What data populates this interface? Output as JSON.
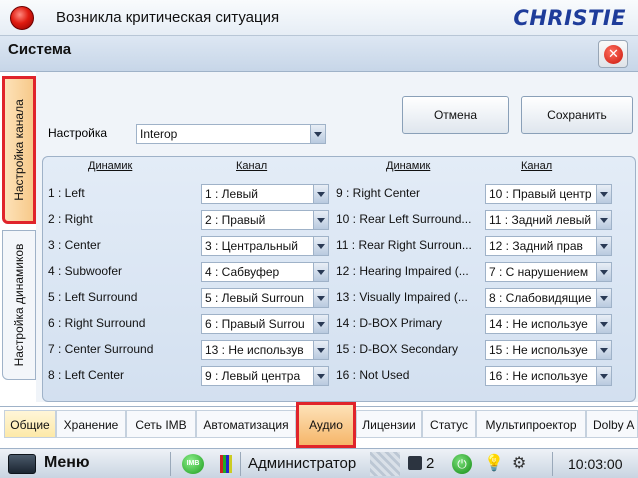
{
  "alert": {
    "text": "Возникла критическая ситуация"
  },
  "brand": "CHRISTIE",
  "window": {
    "title": "Система",
    "close_icon": "close-icon"
  },
  "side_tabs": [
    {
      "label": "Настройка канала",
      "active": true
    },
    {
      "label": "Настройка динамиков",
      "active": false
    }
  ],
  "actions": {
    "cancel": "Отмена",
    "save": "Сохранить"
  },
  "preset": {
    "label": "Настройка",
    "value": "Interop"
  },
  "columns": {
    "speaker": "Динамик",
    "channel": "Канал"
  },
  "speakers_left": [
    {
      "speaker": "1 : Left",
      "channel": "1 : Левый"
    },
    {
      "speaker": "2 : Right",
      "channel": "2 : Правый"
    },
    {
      "speaker": "3 : Center",
      "channel": "3 : Центральный"
    },
    {
      "speaker": "4 : Subwoofer",
      "channel": "4 : Сабвуфер"
    },
    {
      "speaker": "5 : Left Surround",
      "channel": "5 : Левый Surroun"
    },
    {
      "speaker": "6 : Right Surround",
      "channel": "6 : Правый Surrou"
    },
    {
      "speaker": "7 : Center Surround",
      "channel": "13 : Не использув"
    },
    {
      "speaker": "8 : Left Center",
      "channel": "9 : Левый центра"
    }
  ],
  "speakers_right": [
    {
      "speaker": "9 : Right Center",
      "channel": "10 : Правый центр"
    },
    {
      "speaker": "10 : Rear Left Surround...",
      "channel": "11 : Задний левый"
    },
    {
      "speaker": "11 : Rear Right Surroun...",
      "channel": "12 : Задний прав"
    },
    {
      "speaker": "12 : Hearing Impaired (...",
      "channel": "7 : С нарушением"
    },
    {
      "speaker": "13 : Visually Impaired (...",
      "channel": "8 : Слабовидящие"
    },
    {
      "speaker": "14 : D-BOX Primary",
      "channel": "14 : Не используе"
    },
    {
      "speaker": "15 : D-BOX Secondary",
      "channel": "15 : Не используе"
    },
    {
      "speaker": "16 : Not Used",
      "channel": "16 : Не используе"
    }
  ],
  "bottom_tabs": [
    {
      "label": "Общие"
    },
    {
      "label": "Хранение"
    },
    {
      "label": "Сеть IMB"
    },
    {
      "label": "Автоматизация"
    },
    {
      "label": "Аудио",
      "active": true
    },
    {
      "label": "Лицензии"
    },
    {
      "label": "Статус"
    },
    {
      "label": "Мультипроектор"
    },
    {
      "label": "Dolby A"
    }
  ],
  "taskbar": {
    "menu": "Меню",
    "imb_icon_text": "IMB",
    "user": "Администратор",
    "projector_count": "2",
    "clock": "10:03:00"
  },
  "colors": {
    "accent_red": "#e0242b",
    "active_tab": "#f6b66a",
    "panel_bg": "#d3e0f0"
  }
}
